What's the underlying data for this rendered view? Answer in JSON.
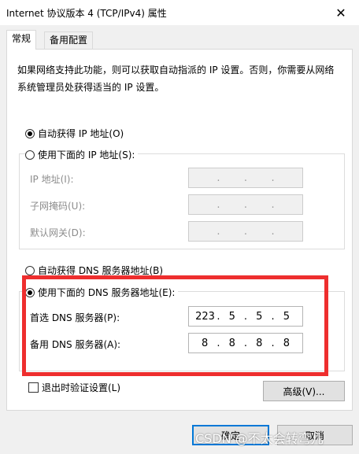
{
  "window": {
    "title": "Internet 协议版本 4 (TCP/IPv4) 属性",
    "close_glyph": "✕"
  },
  "tabs": [
    {
      "label": "常规",
      "active": true
    },
    {
      "label": "备用配置",
      "active": false
    }
  ],
  "description": "如果网络支持此功能，则可以获取自动指派的 IP 设置。否则，你需要从网络系统管理员处获得适当的 IP 设置。",
  "ip_section": {
    "auto_label": "自动获得 IP 地址(O)",
    "auto_checked": true,
    "manual_label": "使用下面的 IP 地址(S):",
    "manual_checked": false,
    "fields": [
      {
        "label": "IP 地址(I):",
        "value": [
          "",
          "",
          "",
          ""
        ]
      },
      {
        "label": "子网掩码(U):",
        "value": [
          "",
          "",
          "",
          ""
        ]
      },
      {
        "label": "默认网关(D):",
        "value": [
          "",
          "",
          "",
          ""
        ]
      }
    ]
  },
  "dns_section": {
    "auto_label": "自动获得 DNS 服务器地址(B)",
    "auto_checked": false,
    "manual_label": "使用下面的 DNS 服务器地址(E):",
    "manual_checked": true,
    "preferred": {
      "label": "首选 DNS 服务器(P):",
      "octets": [
        "223",
        "5",
        "5",
        "5"
      ]
    },
    "alternate": {
      "label": "备用 DNS 服务器(A):",
      "octets": [
        "8",
        "8",
        "8",
        "8"
      ]
    }
  },
  "validate_checkbox": {
    "label": "退出时验证设置(L)",
    "checked": false
  },
  "buttons": {
    "advanced": "高级(V)...",
    "ok": "确定",
    "cancel": "取消"
  },
  "annotation": {
    "color": "#ee2e2e"
  },
  "watermark": "CSDN @不太会转弯儿"
}
